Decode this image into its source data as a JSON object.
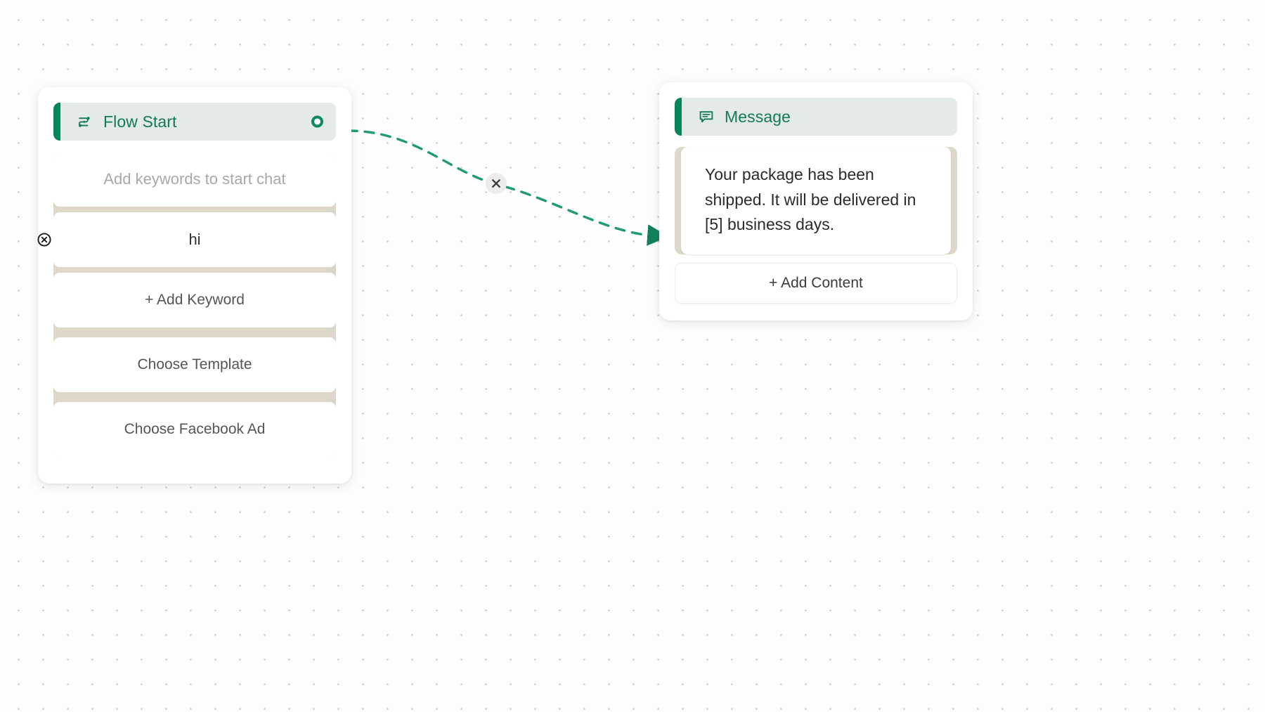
{
  "canvas": {
    "background_color": "#fdfdfd",
    "dot_color": "#bdbdbd",
    "grid_spacing": "35px"
  },
  "theme": {
    "accent_green": "#05855a",
    "title_green": "#137a56",
    "header_bg": "#e3eae7",
    "body_beige": "#ded8ca",
    "edge_green": "#1f9b6e"
  },
  "nodes": {
    "flow_start": {
      "title": "Flow Start",
      "icon": "flow-start-icon",
      "port_name": "output-port",
      "rows": [
        {
          "type": "input",
          "placeholder": "Add keywords to start chat",
          "value": ""
        },
        {
          "type": "keyword",
          "value": "hi",
          "delete_icon": "remove-circle-icon"
        },
        {
          "type": "button",
          "label": "+ Add Keyword"
        },
        {
          "type": "button",
          "label": "Choose Template"
        },
        {
          "type": "button",
          "label": "Choose Facebook Ad"
        }
      ]
    },
    "message": {
      "title": "Message",
      "icon": "chat-bubble-icon",
      "body_text": "Your package has been shipped. It will be delivered in [5] business days.",
      "add_content_label": "+ Add Content"
    }
  },
  "edge": {
    "style": "dashed",
    "color": "#1f9b6e",
    "delete_icon": "close-icon",
    "delete_label": "×",
    "source": "Flow Start",
    "target": "Message"
  }
}
